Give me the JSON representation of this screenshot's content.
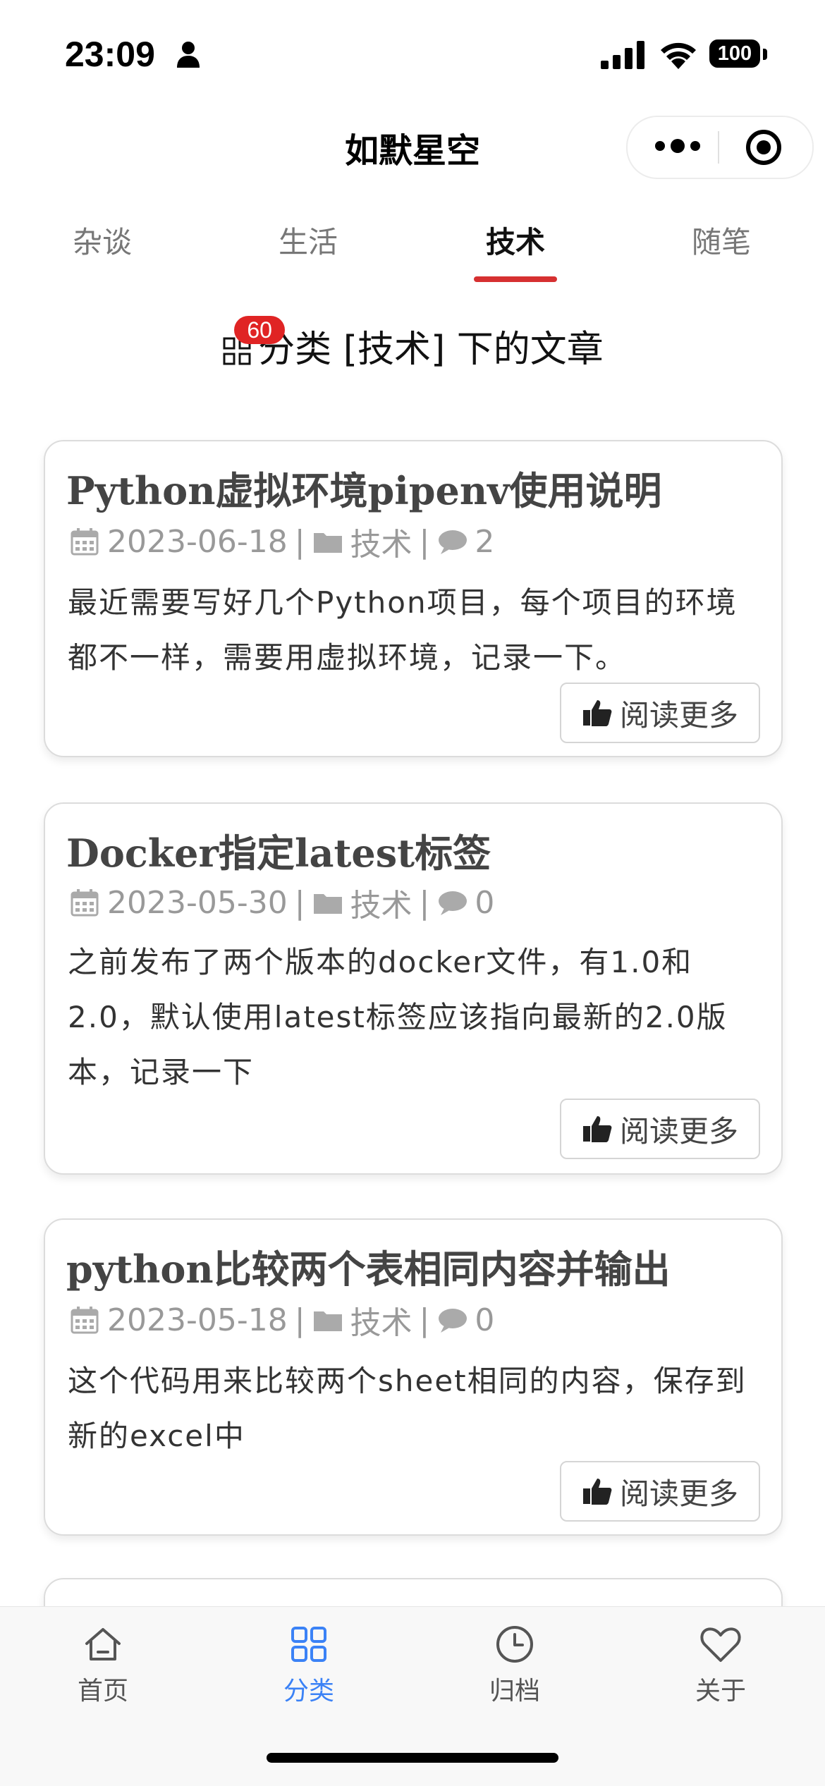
{
  "status_bar": {
    "time": "23:09",
    "battery": "100"
  },
  "nav": {
    "title": "如默星空"
  },
  "tabs": [
    {
      "label": "杂谈",
      "active": false
    },
    {
      "label": "生活",
      "active": false
    },
    {
      "label": "技术",
      "active": true
    },
    {
      "label": "随笔",
      "active": false
    }
  ],
  "heading": {
    "badge": "60",
    "text": "分类 [技术] 下的文章"
  },
  "posts": [
    {
      "title": "Python虚拟环境pipenv使用说明",
      "date": "2023-06-18",
      "category": "技术",
      "comments": "2",
      "excerpt": "最近需要写好几个Python项目，每个项目的环境都不一样，需要用虚拟环境，记录一下。",
      "read_more": "阅读更多"
    },
    {
      "title": "Docker指定latest标签",
      "date": "2023-05-30",
      "category": "技术",
      "comments": "0",
      "excerpt": "之前发布了两个版本的docker文件，有1.0和2.0，默认使用latest标签应该指向最新的2.0版本，记录一下",
      "read_more": "阅读更多"
    },
    {
      "title": "python比较两个表相同内容并输出",
      "date": "2023-05-18",
      "category": "技术",
      "comments": "0",
      "excerpt": "这个代码用来比较两个sheet相同的内容，保存到新的excel中",
      "read_more": "阅读更多"
    }
  ],
  "tabbar": [
    {
      "label": "首页",
      "icon": "home-icon",
      "active": false
    },
    {
      "label": "分类",
      "icon": "category-icon",
      "active": true
    },
    {
      "label": "归档",
      "icon": "clock-icon",
      "active": false
    },
    {
      "label": "关于",
      "icon": "heart-icon",
      "active": false
    }
  ],
  "colors": {
    "accent_red": "#d63031",
    "badge_red": "#e02424",
    "active_blue": "#3b82f6"
  }
}
